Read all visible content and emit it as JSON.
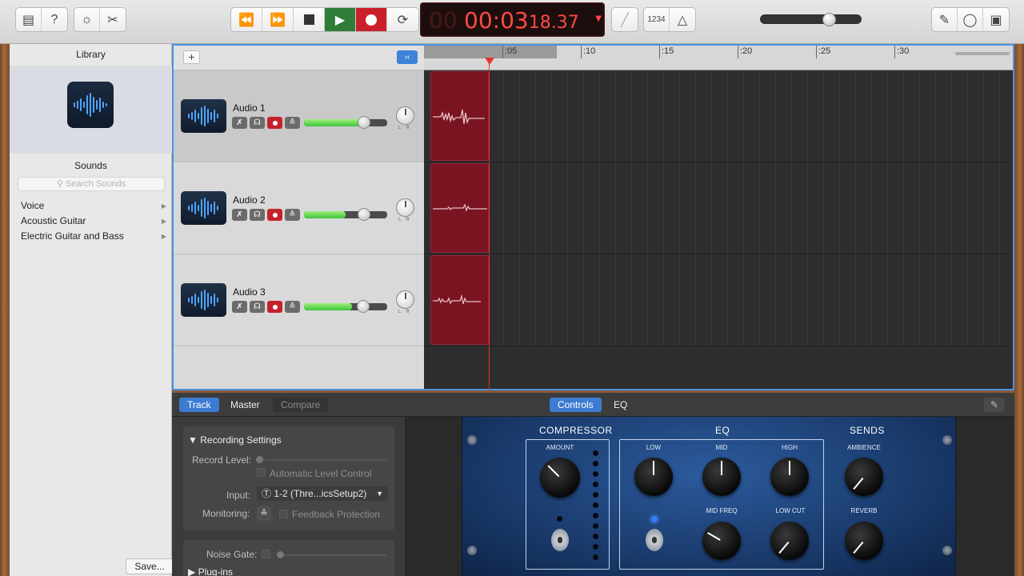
{
  "toolbar": {
    "lcd_dim": "00",
    "lcd_time": "00:03",
    "lcd_frac": "18.37",
    "count_in": "1234"
  },
  "library": {
    "title": "Library",
    "sounds_title": "Sounds",
    "search_placeholder": "Search Sounds",
    "items": [
      {
        "label": "Voice"
      },
      {
        "label": "Acoustic Guitar"
      },
      {
        "label": "Electric Guitar and Bass"
      }
    ],
    "save_label": "Save..."
  },
  "tracks": {
    "add_label": "+",
    "ruler_ticks": [
      ":05",
      ":10",
      ":15",
      ":20",
      ":25",
      ":30"
    ],
    "list": [
      {
        "name": "Audio 1",
        "level": 0.72
      },
      {
        "name": "Audio 2",
        "level": 0.5
      },
      {
        "name": "Audio 3",
        "level": 0.58
      }
    ]
  },
  "smart": {
    "tabs": {
      "track": "Track",
      "master": "Master",
      "compare": "Compare"
    },
    "view_tabs": {
      "controls": "Controls",
      "eq": "EQ"
    },
    "recording_settings": "Recording Settings",
    "record_level_label": "Record Level:",
    "auto_level_label": "Automatic Level Control",
    "input_label": "Input:",
    "input_value": "1-2  (Thre...icsSetup2)",
    "monitoring_label": "Monitoring:",
    "feedback_label": "Feedback Protection",
    "noise_gate_label": "Noise Gate:",
    "plugins_label": "Plug-ins"
  },
  "plugin": {
    "compressor": "COMPRESSOR",
    "eq": "EQ",
    "sends": "SENDS",
    "amount": "AMOUNT",
    "low": "LOW",
    "mid": "MID",
    "high": "HIGH",
    "mid_freq": "MID FREQ",
    "low_cut": "LOW CUT",
    "ambience": "AMBIENCE",
    "reverb": "REVERB"
  },
  "colors": {
    "accent": "#3d7bd1",
    "record": "#c5212a",
    "play": "#2f7d38",
    "region": "#7a1421"
  }
}
